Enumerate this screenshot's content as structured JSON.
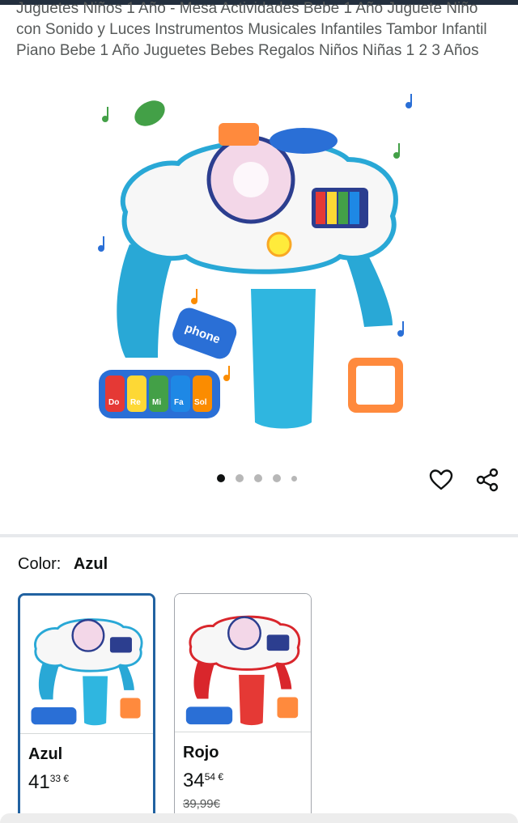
{
  "product": {
    "title": "Juguetes Niños 1 Año - Mesa Actividades Bebe 1 Año Juguete Niño con Sonido y Luces Instrumentos Musicales Infantiles Tambor Infantil Piano Bebe 1 Año Juguetes Bebes Regalos Niños Niñas 1 2 3 Años",
    "image_text": {
      "phone": "phone",
      "keys": [
        "Do",
        "Re",
        "Mi",
        "Fa",
        "Sol"
      ]
    }
  },
  "carousel": {
    "count": 5,
    "active_index": 0
  },
  "actions": {
    "favorite_icon": "heart-icon",
    "share_icon": "share-icon"
  },
  "variation": {
    "label": "Color:",
    "selected": "Azul",
    "options": [
      {
        "name": "Azul",
        "price_whole": "41",
        "price_fraction": "33 €",
        "list_price": "",
        "color": "#29a8d6"
      },
      {
        "name": "Rojo",
        "price_whole": "34",
        "price_fraction": "54 €",
        "list_price": "39,99€",
        "color": "#d9262c"
      }
    ]
  }
}
